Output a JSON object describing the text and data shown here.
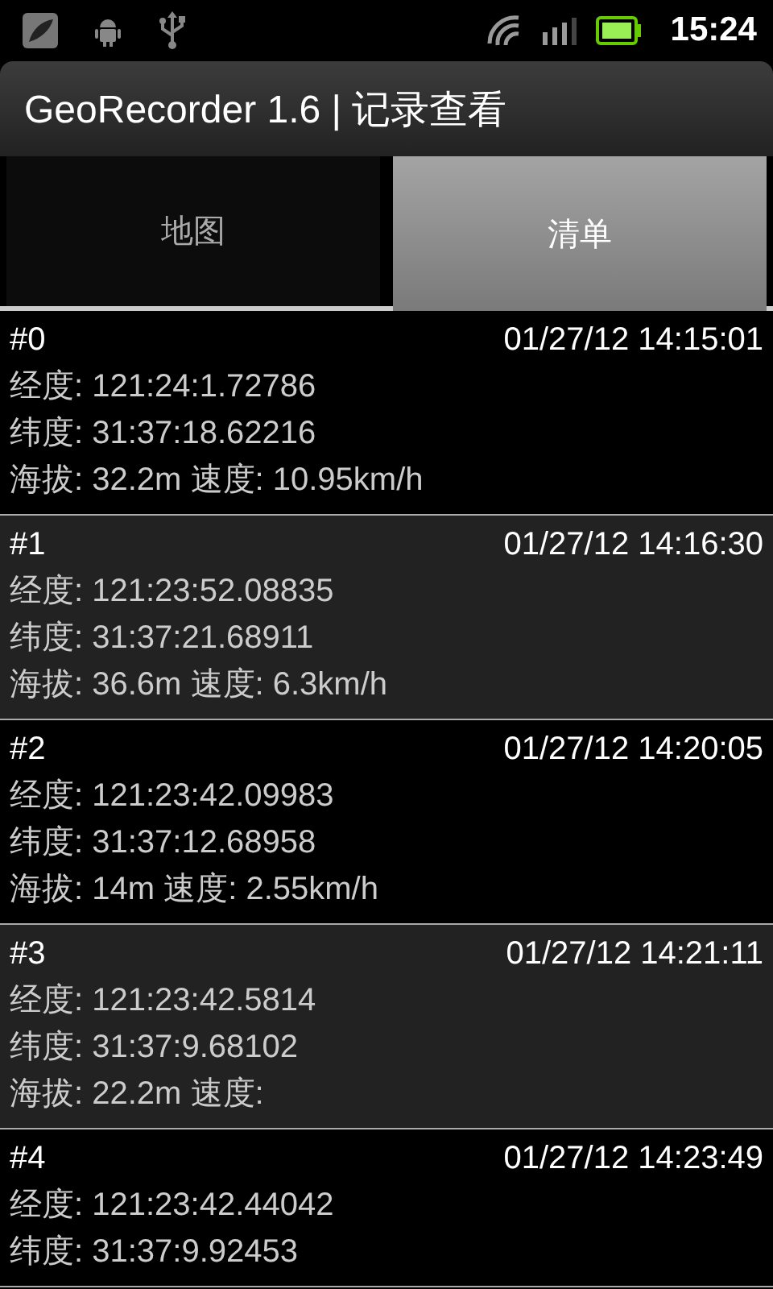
{
  "status_bar": {
    "time": "15:24"
  },
  "title": "GeoRecorder 1.6 | 记录查看",
  "tabs": [
    {
      "label": "地图",
      "selected": false
    },
    {
      "label": "清单",
      "selected": true
    }
  ],
  "records": [
    {
      "index": "#0",
      "time": "01/27/12 14:15:01",
      "lines": [
        "经度: 121:24:1.72786",
        "纬度: 31:37:18.62216",
        "海拔: 32.2m 速度: 10.95km/h"
      ]
    },
    {
      "index": "#1",
      "time": "01/27/12 14:16:30",
      "lines": [
        "经度: 121:23:52.08835",
        "纬度: 31:37:21.68911",
        "海拔: 36.6m 速度: 6.3km/h"
      ]
    },
    {
      "index": "#2",
      "time": "01/27/12 14:20:05",
      "lines": [
        "经度: 121:23:42.09983",
        "纬度: 31:37:12.68958",
        "海拔: 14m 速度: 2.55km/h"
      ]
    },
    {
      "index": "#3",
      "time": "01/27/12 14:21:11",
      "lines": [
        "经度: 121:23:42.5814",
        "纬度: 31:37:9.68102",
        "海拔: 22.2m 速度:"
      ]
    },
    {
      "index": "#4",
      "time": "01/27/12 14:23:49",
      "lines": [
        "经度: 121:23:42.44042",
        "纬度: 31:37:9.92453"
      ]
    }
  ]
}
